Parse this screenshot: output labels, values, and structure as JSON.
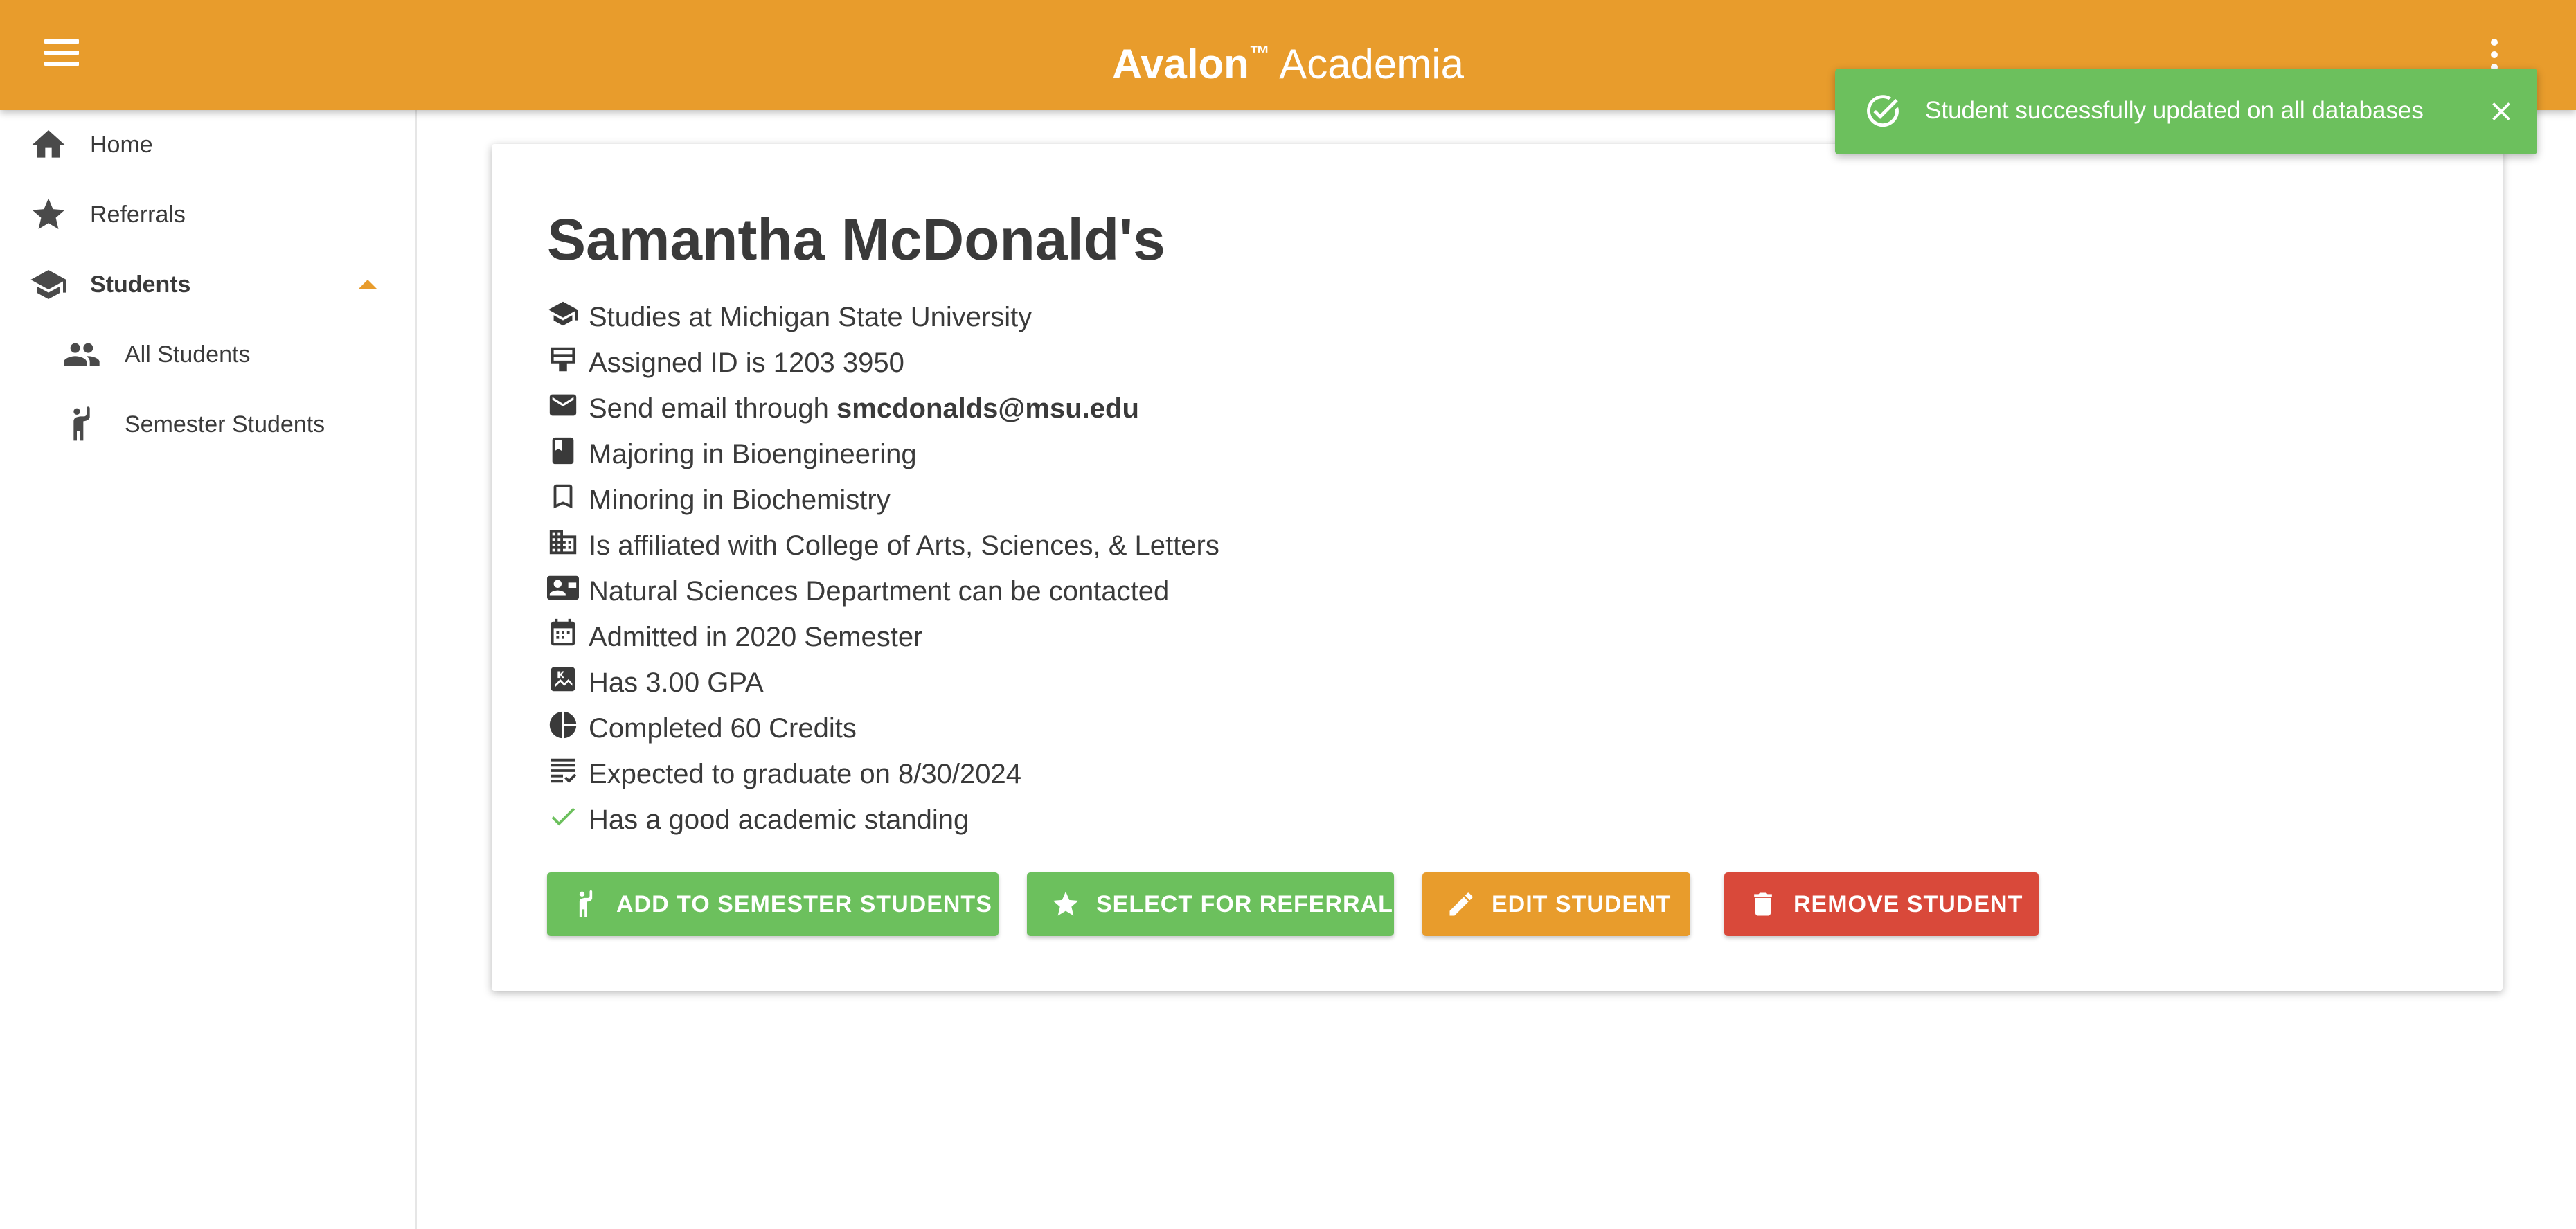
{
  "appbar": {
    "brand_bold": "Avalon",
    "brand_tm": "™",
    "brand_rest": " Academia"
  },
  "sidebar": {
    "items": [
      {
        "label": "Home",
        "icon": "home-icon"
      },
      {
        "label": "Referrals",
        "icon": "star-icon"
      },
      {
        "label": "Students",
        "icon": "school-icon",
        "expanded": true
      },
      {
        "label": "All Students",
        "icon": "people-icon"
      },
      {
        "label": "Semester Students",
        "icon": "person-raise-hand-icon"
      }
    ]
  },
  "student": {
    "title": "Samantha McDonald's",
    "rows": [
      {
        "icon": "school-icon",
        "text": "Studies at Michigan State University"
      },
      {
        "icon": "badge-icon",
        "text": "Assigned ID is 1203 3950"
      },
      {
        "icon": "email-icon",
        "text": "Send email through ",
        "bold": "smcdonalds@msu.edu"
      },
      {
        "icon": "book-icon",
        "text": "Majoring in Bioengineering"
      },
      {
        "icon": "bookmark-icon",
        "text": "Minoring in Biochemistry"
      },
      {
        "icon": "building-icon",
        "text": "Is affiliated with College of Arts, Sciences, & Letters"
      },
      {
        "icon": "contact-card-icon",
        "text": "Natural Sciences Department can be contacted"
      },
      {
        "icon": "calendar-icon",
        "text": "Admitted in 2020 Semester"
      },
      {
        "icon": "grade-icon",
        "text": "Has 3.00 GPA"
      },
      {
        "icon": "pie-chart-icon",
        "text": "Completed 60 Credits"
      },
      {
        "icon": "checklist-icon",
        "text": "Expected to graduate on 8/30/2024"
      },
      {
        "icon": "check-icon",
        "text": "Has a good academic standing"
      }
    ]
  },
  "actions": {
    "add_semester": "ADD TO SEMESTER STUDENTS",
    "select_referral": "SELECT FOR REFERRAL",
    "edit": "EDIT STUDENT",
    "remove": "REMOVE STUDENT"
  },
  "toast": {
    "message": "Student successfully updated on all databases"
  },
  "colors": {
    "primary": "#e89c2c",
    "success": "#6cc05d",
    "danger": "#d9493a",
    "text": "#3a3a3a"
  }
}
